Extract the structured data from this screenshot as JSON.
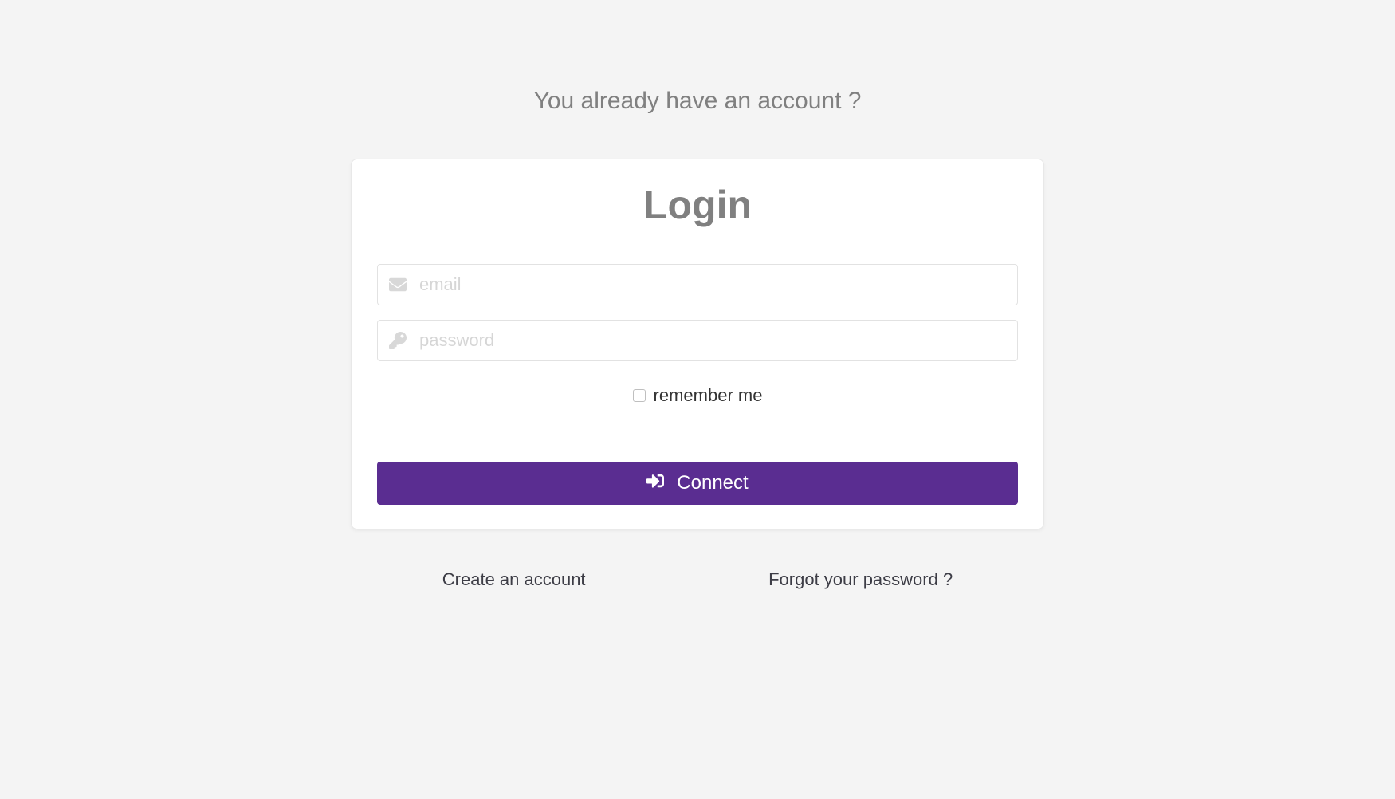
{
  "heading": "You already have an account ?",
  "card": {
    "title": "Login",
    "email": {
      "placeholder": "email",
      "value": ""
    },
    "password": {
      "placeholder": "password",
      "value": ""
    },
    "remember_label": "remember me",
    "connect_label": "Connect"
  },
  "links": {
    "create_account": "Create an account",
    "forgot_password": "Forgot your password ?"
  },
  "colors": {
    "primary": "#5a2d91",
    "background": "#f4f4f4",
    "text_muted": "#808080"
  }
}
